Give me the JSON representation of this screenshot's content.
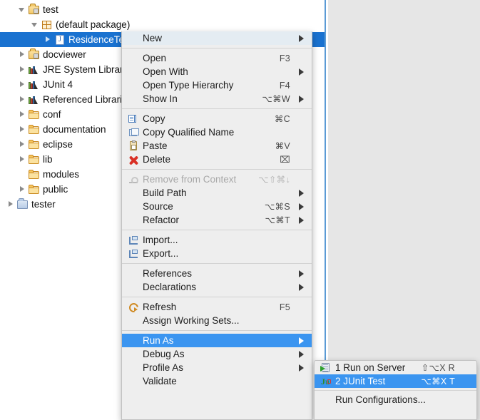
{
  "tree": {
    "items": [
      {
        "indent": 26,
        "twisty": "expanded",
        "icon": "source-folder-icon",
        "label": "test",
        "selected": false
      },
      {
        "indent": 44,
        "twisty": "expanded",
        "icon": "package-icon",
        "label": "(default package)",
        "selected": false
      },
      {
        "indent": 62,
        "twisty": "collapsed",
        "icon": "java-file-icon",
        "label": "ResidenceTest",
        "selected": true
      },
      {
        "indent": 26,
        "twisty": "collapsed",
        "icon": "source-folder-icon",
        "label": "docviewer",
        "selected": false
      },
      {
        "indent": 26,
        "twisty": "collapsed",
        "icon": "library-icon",
        "label": "JRE System Library",
        "selected": false
      },
      {
        "indent": 26,
        "twisty": "collapsed",
        "icon": "library-icon",
        "label": "JUnit 4",
        "selected": false
      },
      {
        "indent": 26,
        "twisty": "collapsed",
        "icon": "library-icon",
        "label": "Referenced Libraries",
        "selected": false
      },
      {
        "indent": 26,
        "twisty": "collapsed",
        "icon": "folder-icon",
        "label": "conf",
        "selected": false
      },
      {
        "indent": 26,
        "twisty": "collapsed",
        "icon": "folder-icon",
        "label": "documentation",
        "selected": false
      },
      {
        "indent": 26,
        "twisty": "collapsed",
        "icon": "folder-icon",
        "label": "eclipse",
        "selected": false
      },
      {
        "indent": 26,
        "twisty": "collapsed",
        "icon": "folder-icon",
        "label": "lib",
        "selected": false
      },
      {
        "indent": 26,
        "twisty": "none",
        "icon": "folder-icon",
        "label": "modules",
        "selected": false
      },
      {
        "indent": 26,
        "twisty": "collapsed",
        "icon": "folder-icon",
        "label": "public",
        "selected": false
      },
      {
        "indent": 10,
        "twisty": "collapsed",
        "icon": "linked-folder-icon",
        "label": "tester",
        "selected": false
      }
    ]
  },
  "context_menu": {
    "items": [
      {
        "label": "New",
        "accel": "",
        "arrow": true,
        "icon": "",
        "state": "hover"
      },
      {
        "type": "separator"
      },
      {
        "label": "Open",
        "accel": "F3",
        "arrow": false,
        "icon": "",
        "state": "normal"
      },
      {
        "label": "Open With",
        "accel": "",
        "arrow": true,
        "icon": "",
        "state": "normal"
      },
      {
        "label": "Open Type Hierarchy",
        "accel": "F4",
        "arrow": false,
        "icon": "",
        "state": "normal"
      },
      {
        "label": "Show In",
        "accel": "⌥⌘W",
        "arrow": true,
        "icon": "",
        "state": "normal"
      },
      {
        "type": "separator"
      },
      {
        "label": "Copy",
        "accel": "⌘C",
        "arrow": false,
        "icon": "copy-icon",
        "state": "normal"
      },
      {
        "label": "Copy Qualified Name",
        "accel": "",
        "arrow": false,
        "icon": "copy-qualified-name-icon",
        "state": "normal"
      },
      {
        "label": "Paste",
        "accel": "⌘V",
        "arrow": false,
        "icon": "paste-icon",
        "state": "normal"
      },
      {
        "label": "Delete",
        "accel": "⌧",
        "arrow": false,
        "icon": "delete-icon",
        "state": "normal"
      },
      {
        "type": "separator"
      },
      {
        "label": "Remove from Context",
        "accel": "⌥⇧⌘↓",
        "arrow": false,
        "icon": "remove-from-context-icon",
        "state": "disabled"
      },
      {
        "label": "Build Path",
        "accel": "",
        "arrow": true,
        "icon": "",
        "state": "normal"
      },
      {
        "label": "Source",
        "accel": "⌥⌘S",
        "arrow": true,
        "icon": "",
        "state": "normal"
      },
      {
        "label": "Refactor",
        "accel": "⌥⌘T",
        "arrow": true,
        "icon": "",
        "state": "normal"
      },
      {
        "type": "separator"
      },
      {
        "label": "Import...",
        "accel": "",
        "arrow": false,
        "icon": "import-icon",
        "state": "normal"
      },
      {
        "label": "Export...",
        "accel": "",
        "arrow": false,
        "icon": "export-icon",
        "state": "normal"
      },
      {
        "type": "separator"
      },
      {
        "label": "References",
        "accel": "",
        "arrow": true,
        "icon": "",
        "state": "normal"
      },
      {
        "label": "Declarations",
        "accel": "",
        "arrow": true,
        "icon": "",
        "state": "normal"
      },
      {
        "type": "separator"
      },
      {
        "label": "Refresh",
        "accel": "F5",
        "arrow": false,
        "icon": "refresh-icon",
        "state": "normal"
      },
      {
        "label": "Assign Working Sets...",
        "accel": "",
        "arrow": false,
        "icon": "",
        "state": "normal"
      },
      {
        "type": "separator"
      },
      {
        "label": "Run As",
        "accel": "",
        "arrow": true,
        "icon": "",
        "state": "selected"
      },
      {
        "label": "Debug As",
        "accel": "",
        "arrow": true,
        "icon": "",
        "state": "normal"
      },
      {
        "label": "Profile As",
        "accel": "",
        "arrow": true,
        "icon": "",
        "state": "normal"
      },
      {
        "label": "Validate",
        "accel": "",
        "arrow": false,
        "icon": "",
        "state": "normal"
      }
    ]
  },
  "submenu": {
    "items": [
      {
        "label": "1 Run on Server",
        "accel": "⇧⌥X R",
        "icon": "run-on-server-icon",
        "state": "normal"
      },
      {
        "label": "2 JUnit Test",
        "accel": "⌥⌘X T",
        "icon": "junit-icon",
        "state": "selected"
      },
      {
        "type": "separator"
      },
      {
        "label": "Run Configurations...",
        "accel": "",
        "icon": "",
        "state": "normal"
      }
    ]
  },
  "colors": {
    "tree_selection": "#1a72d0",
    "menu_selection": "#3b95f0",
    "menu_background": "#eeeeee",
    "panel_background": "#e6e6e6"
  }
}
